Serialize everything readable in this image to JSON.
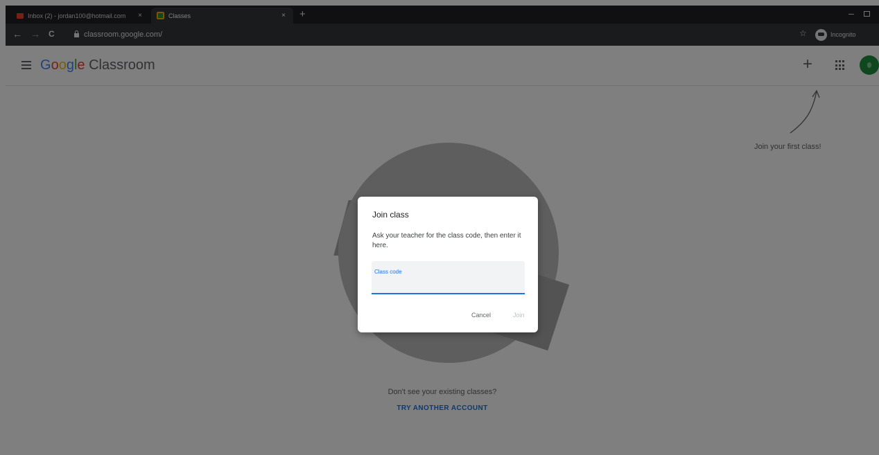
{
  "browser": {
    "tabs": [
      {
        "title": "Inbox (2) - jordan100@hotmail.com",
        "close": "×",
        "active": false
      },
      {
        "title": "Classes",
        "close": "×",
        "active": true
      }
    ],
    "new_tab": "+",
    "window_controls": {
      "minimize": "–",
      "close": "×"
    },
    "nav": {
      "back": "←",
      "forward": "→",
      "reload": "C"
    },
    "url": "classroom.google.com/",
    "bookmark": "☆",
    "profile_label": "Incognito"
  },
  "header": {
    "brand_google": [
      "G",
      "o",
      "o",
      "g",
      "l",
      "e"
    ],
    "brand_product": " Classroom",
    "add_button": "+"
  },
  "empty_state": {
    "hint": "Join your first class!",
    "question": "Don't see your existing classes?",
    "switch_account": "TRY ANOTHER ACCOUNT"
  },
  "dialog": {
    "title": "Join class",
    "body": "Ask your teacher for the class code, then enter it here.",
    "field_label": "Class code",
    "field_value": "",
    "cancel_label": "Cancel",
    "join_label": "Join"
  },
  "colors": {
    "accent": "#1a73e8",
    "scrim": "#808080",
    "avatar": "#1e8e3e"
  }
}
